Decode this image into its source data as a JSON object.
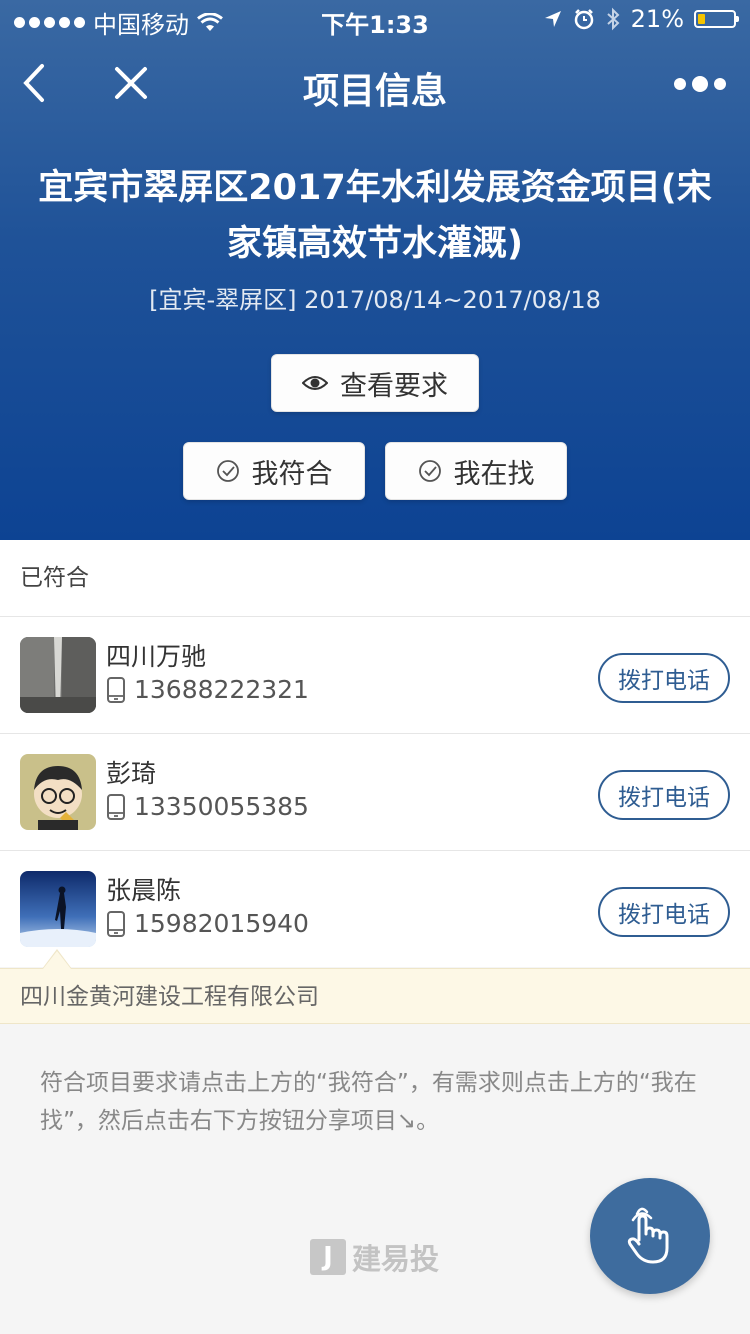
{
  "status_bar": {
    "carrier": "中国移动",
    "time": "下午1:33",
    "battery_percent": "21%",
    "battery_level": 0.21
  },
  "nav": {
    "title": "项目信息"
  },
  "project": {
    "title": "宜宾市翠屏区2017年水利发展资金项目(宋家镇高效节水灌溉)",
    "meta": "[宜宾-翠屏区] 2017/08/14~2017/08/18",
    "view_requirements_label": "查看要求",
    "match_label": "我符合",
    "seek_label": "我在找"
  },
  "matched": {
    "section_title": "已符合",
    "call_label": "拨打电话",
    "contacts": [
      {
        "name": "四川万驰",
        "phone": "13688222321"
      },
      {
        "name": "彭琦",
        "phone": "13350055385"
      },
      {
        "name": "张晨陈",
        "phone": "15982015940"
      }
    ],
    "company": "四川金黄河建设工程有限公司"
  },
  "hint": "符合项目要求请点击上方的“我符合”，有需求则点击上方的“我在找”，然后点击右下方按钮分享项目↘。",
  "brand": {
    "logo_letter": "J",
    "name": "建易投"
  },
  "colors": {
    "header_top": "#3a69a3",
    "header_bottom": "#0d4393",
    "accent": "#2f5d92",
    "fab": "#3e6c9e"
  }
}
